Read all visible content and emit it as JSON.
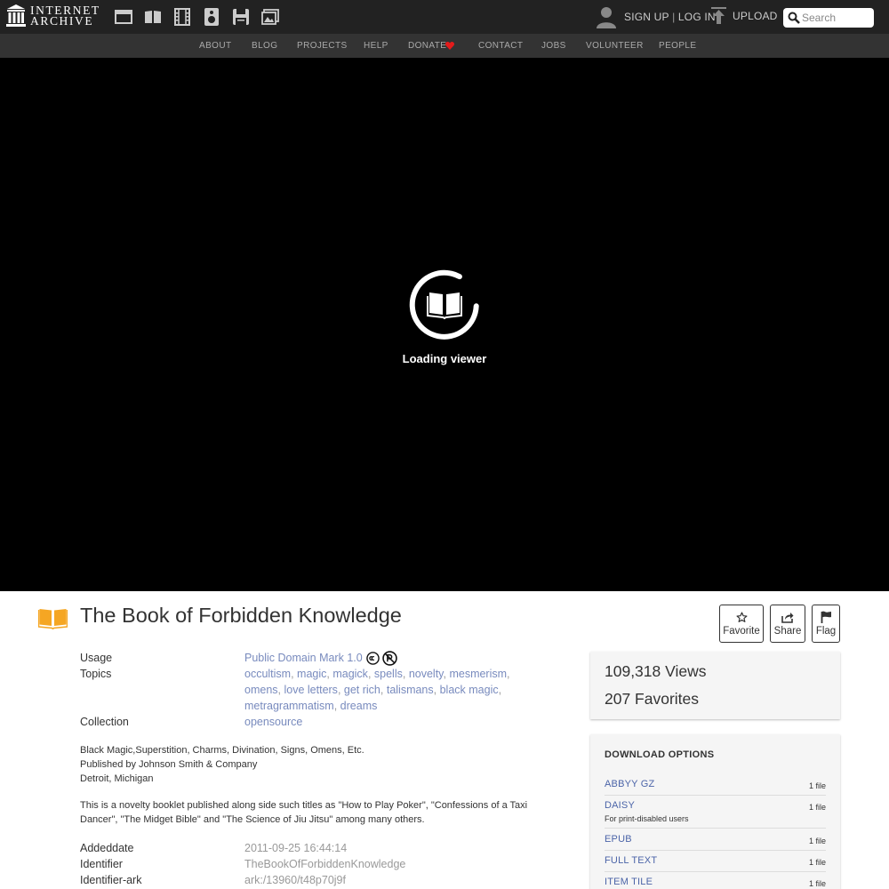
{
  "header": {
    "logo_line1": "INTERNET",
    "logo_line2": "ARCHIVE",
    "media_icons": [
      "web-icon",
      "texts-icon",
      "video-icon",
      "audio-icon",
      "software-icon",
      "images-icon"
    ],
    "sign_up": "SIGN UP",
    "separator": " | ",
    "log_in": "LOG IN",
    "upload": "UPLOAD",
    "search_placeholder": "Search"
  },
  "nav": {
    "items": [
      "ABOUT",
      "BLOG",
      "PROJECTS",
      "HELP",
      "DONATE",
      "CONTACT",
      "JOBS",
      "VOLUNTEER",
      "PEOPLE"
    ]
  },
  "viewer": {
    "loading_text": "Loading viewer"
  },
  "item": {
    "title": "The Book of Forbidden Knowledge",
    "actions": {
      "favorite": "Favorite",
      "share": "Share",
      "flag": "Flag"
    }
  },
  "metadata": {
    "usage_label": "Usage",
    "usage_value": "Public Domain Mark 1.0",
    "topics_label": "Topics",
    "topics": [
      "occultism",
      "magic",
      "magick",
      "spells",
      "novelty",
      "mesmerism",
      "omens",
      "love letters",
      "get rich",
      "talismans",
      "black magic",
      "metragrammatism",
      "dreams"
    ],
    "collection_label": "Collection",
    "collection_value": "opensource",
    "description_lines": [
      "Black Magic,Superstition, Charms, Divination, Signs, Omens, Etc.",
      "Published by Johnson Smith & Company",
      "Detroit, Michigan"
    ],
    "description_paragraph_line1": "This is a novelty booklet published along side such titles as \"How to Play Poker\", \"Confessions of a Taxi",
    "description_paragraph_line2": "Dancer\", \"The Midget Bible\" and \"The Science of Jiu Jitsu\" among many others.",
    "addeddate_label": "Addeddate",
    "addeddate_value": "2011-09-25 16:44:14",
    "identifier_label": "Identifier",
    "identifier_value": "TheBookOfForbiddenKnowledge",
    "identifier_ark_label": "Identifier-ark",
    "identifier_ark_value": "ark:/13960/t48p70j9f"
  },
  "stats": {
    "views": "109,318 Views",
    "favorites": "207 Favorites"
  },
  "downloads": {
    "title": "DOWNLOAD OPTIONS",
    "options": [
      {
        "format": "ABBYY GZ",
        "sub": "",
        "count": "1 file"
      },
      {
        "format": "DAISY",
        "sub": "For print-disabled users",
        "count": "1 file"
      },
      {
        "format": "EPUB",
        "sub": "",
        "count": "1 file"
      },
      {
        "format": "FULL TEXT",
        "sub": "",
        "count": "1 file"
      },
      {
        "format": "ITEM TILE",
        "sub": "",
        "count": "1 file"
      }
    ]
  },
  "colors": {
    "topbar": "#222222",
    "navbar": "#333333",
    "link": "#4b64a8",
    "donate_heart": "#e41b1b",
    "book_icon": "#f5a623"
  }
}
